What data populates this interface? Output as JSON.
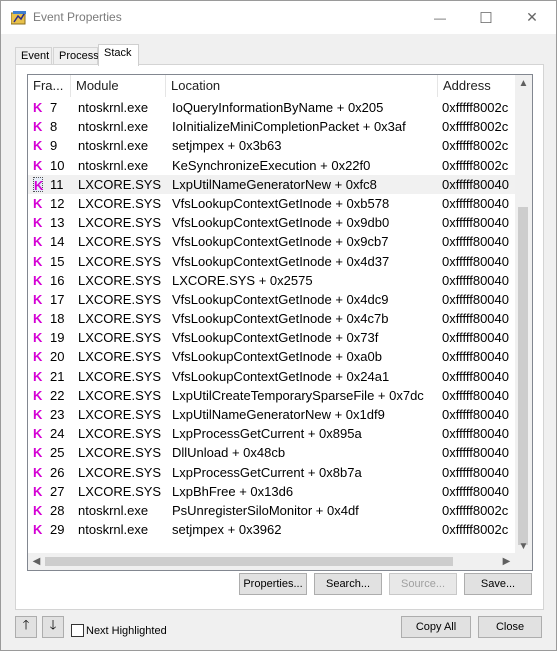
{
  "window": {
    "title": "Event Properties",
    "controls": {
      "minimize": "—",
      "maximize": "☐",
      "close": "✕"
    }
  },
  "tabs": [
    {
      "label": "Event"
    },
    {
      "label": "Process"
    },
    {
      "label": "Stack",
      "active": true
    }
  ],
  "columns": [
    "Fra...",
    "Module",
    "Location",
    "Address"
  ],
  "frames": [
    {
      "badge": "K",
      "frame": "7",
      "module": "ntoskrnl.exe",
      "location": "IoQueryInformationByName + 0x205",
      "address": "0xfffff8002c"
    },
    {
      "badge": "K",
      "frame": "8",
      "module": "ntoskrnl.exe",
      "location": "IoInitializeMiniCompletionPacket + 0x3af",
      "address": "0xfffff8002c"
    },
    {
      "badge": "K",
      "frame": "9",
      "module": "ntoskrnl.exe",
      "location": "setjmpex + 0x3b63",
      "address": "0xfffff8002c"
    },
    {
      "badge": "K",
      "frame": "10",
      "module": "ntoskrnl.exe",
      "location": "KeSynchronizeExecution + 0x22f0",
      "address": "0xfffff8002c"
    },
    {
      "badge": "K",
      "frame": "11",
      "module": "LXCORE.SYS",
      "location": "LxpUtilNameGeneratorNew + 0xfc8",
      "address": "0xfffff80040",
      "highlight": true
    },
    {
      "badge": "K",
      "frame": "12",
      "module": "LXCORE.SYS",
      "location": "VfsLookupContextGetInode + 0xb578",
      "address": "0xfffff80040"
    },
    {
      "badge": "K",
      "frame": "13",
      "module": "LXCORE.SYS",
      "location": "VfsLookupContextGetInode + 0x9db0",
      "address": "0xfffff80040"
    },
    {
      "badge": "K",
      "frame": "14",
      "module": "LXCORE.SYS",
      "location": "VfsLookupContextGetInode + 0x9cb7",
      "address": "0xfffff80040"
    },
    {
      "badge": "K",
      "frame": "15",
      "module": "LXCORE.SYS",
      "location": "VfsLookupContextGetInode + 0x4d37",
      "address": "0xfffff80040"
    },
    {
      "badge": "K",
      "frame": "16",
      "module": "LXCORE.SYS",
      "location": "LXCORE.SYS + 0x2575",
      "address": "0xfffff80040"
    },
    {
      "badge": "K",
      "frame": "17",
      "module": "LXCORE.SYS",
      "location": "VfsLookupContextGetInode + 0x4dc9",
      "address": "0xfffff80040"
    },
    {
      "badge": "K",
      "frame": "18",
      "module": "LXCORE.SYS",
      "location": "VfsLookupContextGetInode + 0x4c7b",
      "address": "0xfffff80040"
    },
    {
      "badge": "K",
      "frame": "19",
      "module": "LXCORE.SYS",
      "location": "VfsLookupContextGetInode + 0x73f",
      "address": "0xfffff80040"
    },
    {
      "badge": "K",
      "frame": "20",
      "module": "LXCORE.SYS",
      "location": "VfsLookupContextGetInode + 0xa0b",
      "address": "0xfffff80040"
    },
    {
      "badge": "K",
      "frame": "21",
      "module": "LXCORE.SYS",
      "location": "VfsLookupContextGetInode + 0x24a1",
      "address": "0xfffff80040"
    },
    {
      "badge": "K",
      "frame": "22",
      "module": "LXCORE.SYS",
      "location": "LxpUtilCreateTemporarySparseFile + 0x7dc",
      "address": "0xfffff80040"
    },
    {
      "badge": "K",
      "frame": "23",
      "module": "LXCORE.SYS",
      "location": "LxpUtilNameGeneratorNew + 0x1df9",
      "address": "0xfffff80040"
    },
    {
      "badge": "K",
      "frame": "24",
      "module": "LXCORE.SYS",
      "location": "LxpProcessGetCurrent + 0x895a",
      "address": "0xfffff80040"
    },
    {
      "badge": "K",
      "frame": "25",
      "module": "LXCORE.SYS",
      "location": "DllUnload + 0x48cb",
      "address": "0xfffff80040"
    },
    {
      "badge": "K",
      "frame": "26",
      "module": "LXCORE.SYS",
      "location": "LxpProcessGetCurrent + 0x8b7a",
      "address": "0xfffff80040"
    },
    {
      "badge": "K",
      "frame": "27",
      "module": "LXCORE.SYS",
      "location": "LxpBhFree + 0x13d6",
      "address": "0xfffff80040"
    },
    {
      "badge": "K",
      "frame": "28",
      "module": "ntoskrnl.exe",
      "location": "PsUnregisterSiloMonitor + 0x4df",
      "address": "0xfffff8002c"
    },
    {
      "badge": "K",
      "frame": "29",
      "module": "ntoskrnl.exe",
      "location": "setjmpex + 0x3962",
      "address": "0xfffff8002c"
    }
  ],
  "actions": {
    "properties": "Properties...",
    "search": "Search...",
    "source": "Source...",
    "save": "Save..."
  },
  "footer": {
    "next_highlighted": "Next Highlighted",
    "copy_all": "Copy All",
    "close": "Close"
  },
  "colors": {
    "kernel_badge": "#d400d4",
    "highlight_row": "#f1f1f1"
  }
}
